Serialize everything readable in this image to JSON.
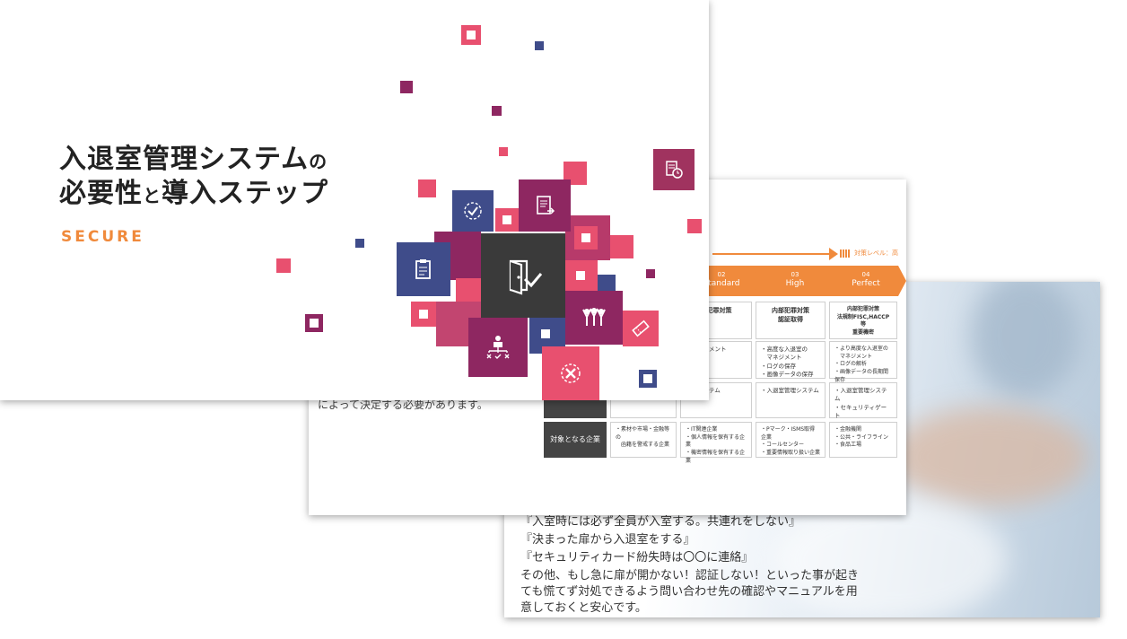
{
  "cover": {
    "title_line1_a": "入退室管理システム",
    "title_line1_b": "の",
    "title_line2_a": "必要性",
    "title_line2_b": "と",
    "title_line2_c": "導入ステップ",
    "logo": "SECURE"
  },
  "table_page": {
    "level_label": "対策レベル：高",
    "stages": [
      {
        "num": "02",
        "label": "Standard"
      },
      {
        "num": "03",
        "label": "High"
      },
      {
        "num": "04",
        "label": "Perfect"
      }
    ],
    "purpose": [
      "部犯罪対策",
      "内部犯罪対策\n認証取得",
      "内部犯罪対策\n法規制FISC,HACCP等\n重要機密"
    ],
    "features": [
      "のマネジメント\n保存",
      "・高度な入退室の\n　マネジメント\n・ログの保存\n・画像データの保存",
      "・より高度な入退室の\n　マネジメント\n・ログの解析\n・画像データの長期間保存"
    ],
    "systems": [
      "ドロック",
      "管理システム",
      "・入退室管理システム",
      "・入退室管理システム\n・セキュリティゲート"
    ],
    "target_head": "対象となる企業",
    "targets": [
      "・素材や市場・金融等の\n　函籍を警戒する企業",
      "・IT関連企業\n・個人情報を保有する企業\n・機密情報を保有する企業",
      "・Pマーク・ISMS取得企業\n・コールセンター\n・重要情報取り扱い企業",
      "・金融機関\n・公共・ライフライン\n・食品工場"
    ],
    "cut_text": "によって決定する必要があります。"
  },
  "photo_page": {
    "line1": "『入室時には必ず全員が入室する。共連れをしない』",
    "line2": "『決まった扉から入退室をする』",
    "line3": "『セキュリティカード紛失時は〇〇に連絡』",
    "line4": "その他、もし急に扉が開かない！認証しない！といった事が起き",
    "line5": "ても慌てず対処できるよう問い合わせ先の確認やマニュアルを用",
    "line6": "意しておくと安心です。"
  },
  "colors": {
    "pink": "#e8506f",
    "purple": "#8e2761",
    "navy": "#3f4c8a",
    "dark": "#3a3a3a",
    "orange": "#f08a3c"
  }
}
